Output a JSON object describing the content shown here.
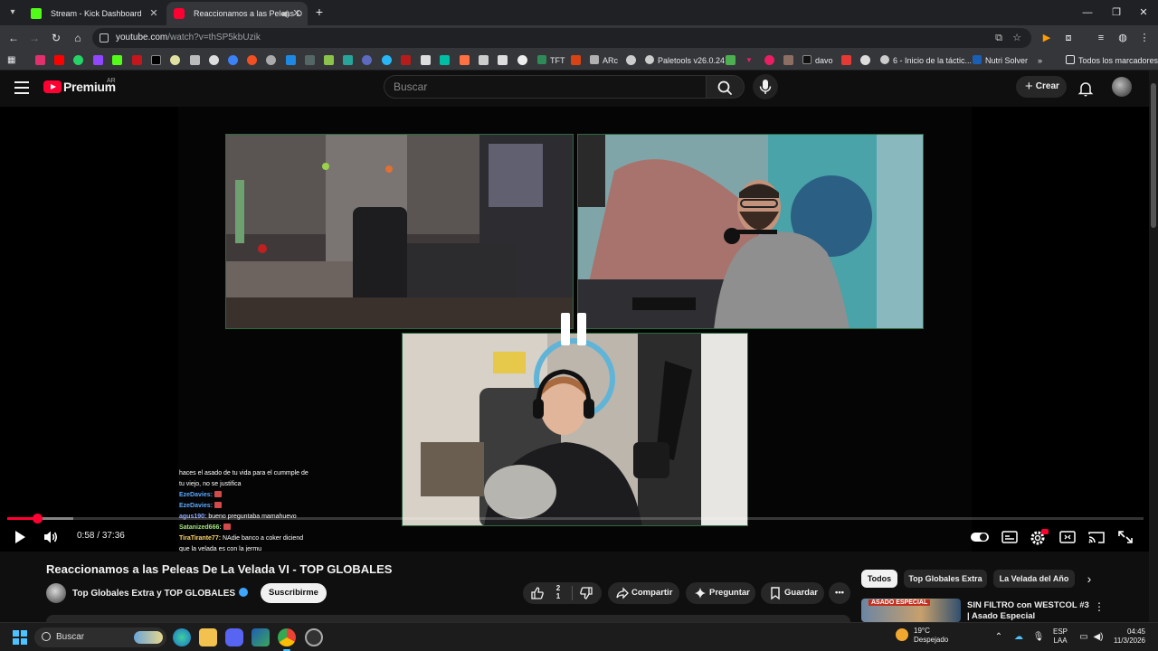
{
  "browser": {
    "tabs": [
      {
        "title": "Stream - Kick Dashboard",
        "favicon_color": "#53fc18",
        "active": false
      },
      {
        "title": "Reaccionamos a las Peleas D",
        "favicon_color": "#ff0033",
        "active": true
      }
    ],
    "url_host": "youtube.com",
    "url_path": "/watch?v=thSP5kbUzik",
    "bookmarks": [
      {
        "label": "TFT",
        "icon_color": "#2e8b57"
      },
      {
        "label": "ARc",
        "icon_color": "#b0b0b0"
      },
      {
        "label": "Paletools v26.0.24",
        "icon_color": "#cccccc"
      },
      {
        "label": "davo",
        "icon_color": "#111111"
      },
      {
        "label": "6 - Inicio de la táctic...",
        "icon_color": "#cccccc"
      },
      {
        "label": "Nutri Solver",
        "icon_color": "#1a5fb4"
      }
    ],
    "bookmarks_more": "»",
    "all_bookmarks": "Todos los marcadores"
  },
  "youtube": {
    "logo_word": "Premium",
    "country_code": "AR",
    "search_placeholder": "Buscar",
    "create_label": "Crear"
  },
  "player": {
    "current_time": "0:58",
    "duration": "37:36",
    "progress_fraction": 0.026,
    "buffered_fraction": 0.058,
    "chat": [
      {
        "user": "",
        "text": "haces el asado de tu vida para el cummple de tu viejo, no se justifica",
        "color": ""
      },
      {
        "user": "EzeDavies:",
        "text": "",
        "color": "blue",
        "emoji": true
      },
      {
        "user": "EzeDavies:",
        "text": "",
        "color": "blue",
        "emoji": true
      },
      {
        "user": "agus190:",
        "text": "bueno preguntaba mamahuevo",
        "color": "gray"
      },
      {
        "user": "Satanized666:",
        "text": "",
        "color": "green",
        "emoji": true
      },
      {
        "user": "TiraTirante77:",
        "text": "NAdie banco a coker diciend que la velada es con la jermu",
        "color": "yellow"
      }
    ]
  },
  "video": {
    "title": "Reaccionamos a las Peleas De La Velada VI - TOP GLOBALES",
    "channel": "Top Globales Extra y TOP GLOBALES",
    "subscribe_label": "Suscribirme",
    "likes": "2",
    "likes_secondary": "1",
    "share_label": "Compartir",
    "ask_label": "Preguntar",
    "save_label": "Guardar"
  },
  "sidebar": {
    "chips": [
      "Todos",
      "Top Globales Extra",
      "La Velada del Año"
    ],
    "recommendation": {
      "thumb_text": "ASADO ESPECIAL",
      "title": "SIN FILTRO con WESTCOL #3 | Asado Especial"
    }
  },
  "taskbar": {
    "search_label": "Buscar",
    "weather_temp": "19°C",
    "weather_desc": "Despejado",
    "lang_top": "ESP",
    "lang_bottom": "LAA",
    "time": "04:45",
    "date": "11/3/2026"
  },
  "colors": {
    "accent": "#ff0033",
    "background": "#0f0f0f",
    "cam_border": "#2d6a3e"
  }
}
